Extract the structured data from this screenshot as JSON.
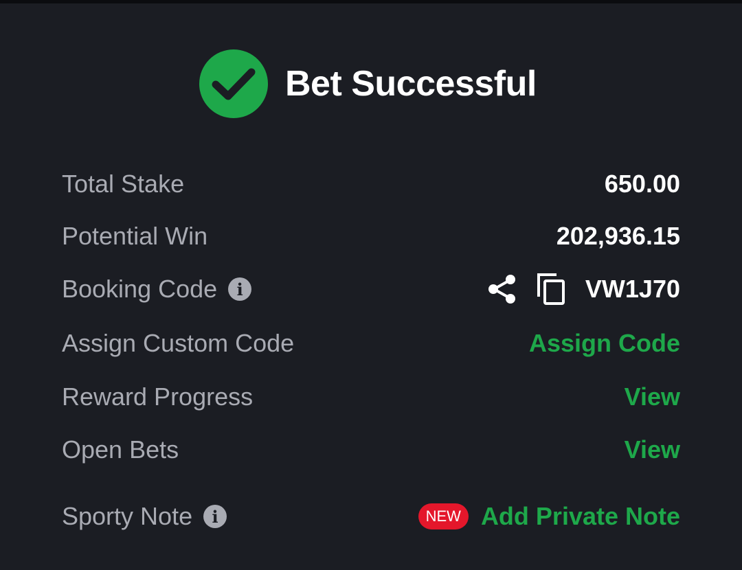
{
  "colors": {
    "background": "#1b1d23",
    "success_green": "#1ea84a",
    "label_gray": "#a9abb3",
    "new_badge_red": "#e4172b"
  },
  "header": {
    "icon": "check-circle-icon",
    "title": "Bet Successful"
  },
  "summary": {
    "total_stake": {
      "label": "Total Stake",
      "value": "650.00"
    },
    "potential_win": {
      "label": "Potential Win",
      "value": "202,936.15"
    },
    "booking_code": {
      "label": "Booking Code",
      "info_icon": "info-icon",
      "share_icon": "share-icon",
      "copy_icon": "copy-icon",
      "value": "VW1J70"
    },
    "custom_code": {
      "label": "Assign Custom Code",
      "action": "Assign Code"
    },
    "reward_progress": {
      "label": "Reward Progress",
      "action": "View"
    },
    "open_bets": {
      "label": "Open Bets",
      "action": "View"
    },
    "sporty_note": {
      "label": "Sporty Note",
      "info_icon": "info-icon",
      "badge": "NEW",
      "action": "Add Private Note"
    }
  }
}
